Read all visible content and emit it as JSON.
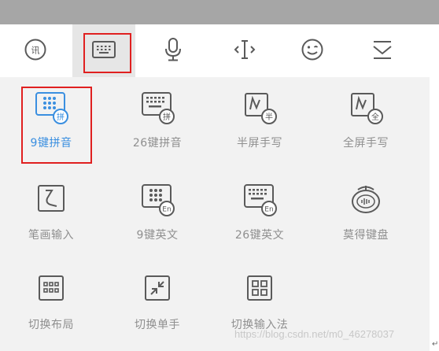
{
  "toolbar": {
    "items": [
      {
        "icon": "voice-to-text-icon",
        "selected": false
      },
      {
        "icon": "keyboard-icon",
        "selected": true
      },
      {
        "icon": "microphone-icon",
        "selected": false
      },
      {
        "icon": "text-cursor-move-icon",
        "selected": false
      },
      {
        "icon": "emoji-icon",
        "selected": false
      },
      {
        "icon": "collapse-keyboard-icon",
        "selected": false
      }
    ]
  },
  "grid": {
    "items": [
      {
        "label": "9键拼音",
        "icon": "keypad-9-pinyin-icon",
        "active": true,
        "badge": "拼"
      },
      {
        "label": "26键拼音",
        "icon": "keypad-26-pinyin-icon",
        "active": false,
        "badge": "拼"
      },
      {
        "label": "半屏手写",
        "icon": "half-screen-handwriting-icon",
        "active": false,
        "badge": "半"
      },
      {
        "label": "全屏手写",
        "icon": "full-screen-handwriting-icon",
        "active": false,
        "badge": "全"
      },
      {
        "label": "笔画输入",
        "icon": "stroke-input-icon",
        "active": false
      },
      {
        "label": "9键英文",
        "icon": "keypad-9-english-icon",
        "active": false,
        "badge": "En"
      },
      {
        "label": "26键英文",
        "icon": "keypad-26-english-icon",
        "active": false,
        "badge": "En"
      },
      {
        "label": "莫得键盘",
        "icon": "mode-keyboard-icon",
        "active": false
      },
      {
        "label": "切换布局",
        "icon": "switch-layout-icon",
        "active": false
      },
      {
        "label": "切换单手",
        "icon": "one-hand-mode-icon",
        "active": false
      },
      {
        "label": "切换输入法",
        "icon": "switch-input-method-icon",
        "active": false
      }
    ]
  },
  "watermark": "https://blog.csdn.net/m0_46278037",
  "corner_mark": "↵",
  "colors": {
    "accent": "#3a8fe0",
    "highlight_border": "#e02020",
    "panel_bg": "#f2f2f2",
    "label_gray": "#8f8f8f",
    "icon_gray": "#5a5a5a",
    "topbar": "#a6a6a6"
  }
}
